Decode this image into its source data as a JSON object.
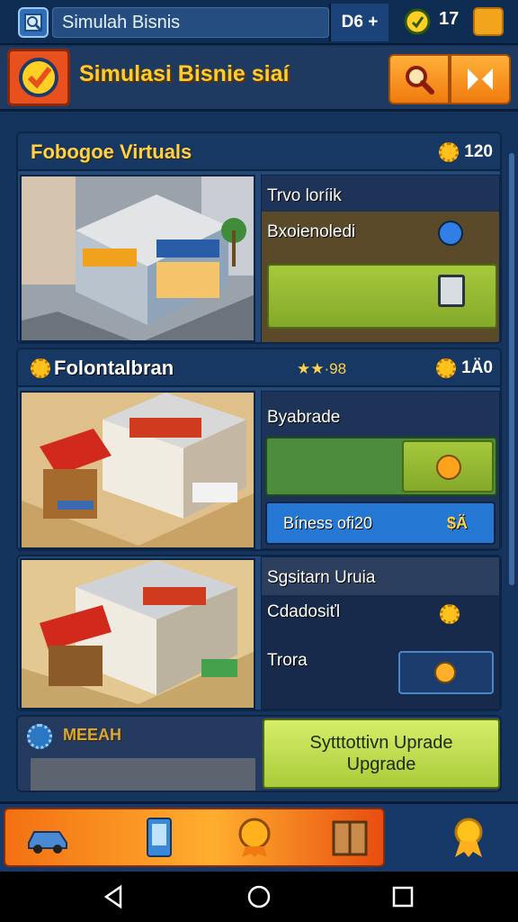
{
  "topbar": {
    "title": "Simulah Bisnis",
    "currency": "D6 +",
    "count": "17",
    "icons": [
      "app-icon",
      "coin-icon",
      "briefcase-icon"
    ]
  },
  "header": {
    "title": "Simulasi Bisnie  siaí",
    "icons": [
      "badge-icon",
      "search-icon",
      "play-icon"
    ],
    "colors": {
      "title": "#ffcc2e",
      "buttons": "#f07a0e"
    }
  },
  "cards": [
    {
      "title": "Fobogoe Virtuals",
      "stat": "120",
      "row1": "Trvo loríik",
      "row2": "Bxoienoledi"
    },
    {
      "title": "Folontalbran",
      "rating": "★★·98",
      "stat": "1Ä0",
      "row1": "Byabrade",
      "button": "Bíness ofi20",
      "button_value": "$Ä"
    },
    {
      "row1": "Sgsitarn Uruia",
      "row2": "Cdadosiťl",
      "row3": "Trora"
    },
    {
      "title": "MEEAH",
      "upgrade_button": "Sytttottivn Uprade Upgrade"
    }
  ],
  "nav": {
    "items": [
      "car-icon",
      "phone-icon",
      "medal-icon",
      "crate-icon",
      "ribbon-icon"
    ]
  },
  "system": {
    "buttons": [
      "back-icon",
      "home-icon",
      "recents-icon"
    ]
  }
}
